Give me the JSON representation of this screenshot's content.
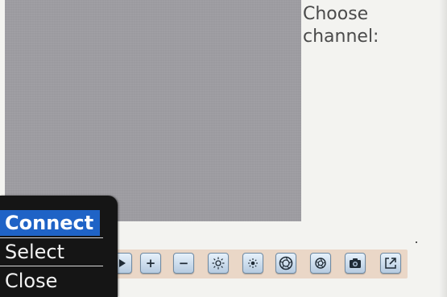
{
  "channel_panel": {
    "label": "Choose channel:"
  },
  "toolbar": {
    "buttons": [
      {
        "name": "play-button",
        "icon": "play-icon"
      },
      {
        "name": "zoom-in-button",
        "icon": "plus-icon",
        "glyph": "+"
      },
      {
        "name": "zoom-out-button",
        "icon": "minus-icon",
        "glyph": "−"
      },
      {
        "name": "brightness-up-button",
        "icon": "sun-large-icon"
      },
      {
        "name": "brightness-down-button",
        "icon": "sun-small-icon"
      },
      {
        "name": "contrast-up-button",
        "icon": "aperture-large-icon"
      },
      {
        "name": "contrast-down-button",
        "icon": "aperture-small-icon"
      },
      {
        "name": "snapshot-button",
        "icon": "camera-icon"
      },
      {
        "name": "external-window-button",
        "icon": "external-link-icon"
      }
    ]
  },
  "context_menu": {
    "items": [
      {
        "label": "Connect",
        "selected": true
      },
      {
        "label": "Select",
        "selected": false
      },
      {
        "label": "Close",
        "selected": false
      }
    ]
  },
  "colors": {
    "menu_highlight": "#1f63c6",
    "menu_background": "#151515",
    "toolbar_background": "#ead7c7",
    "video_background": "#9b9a9f"
  }
}
